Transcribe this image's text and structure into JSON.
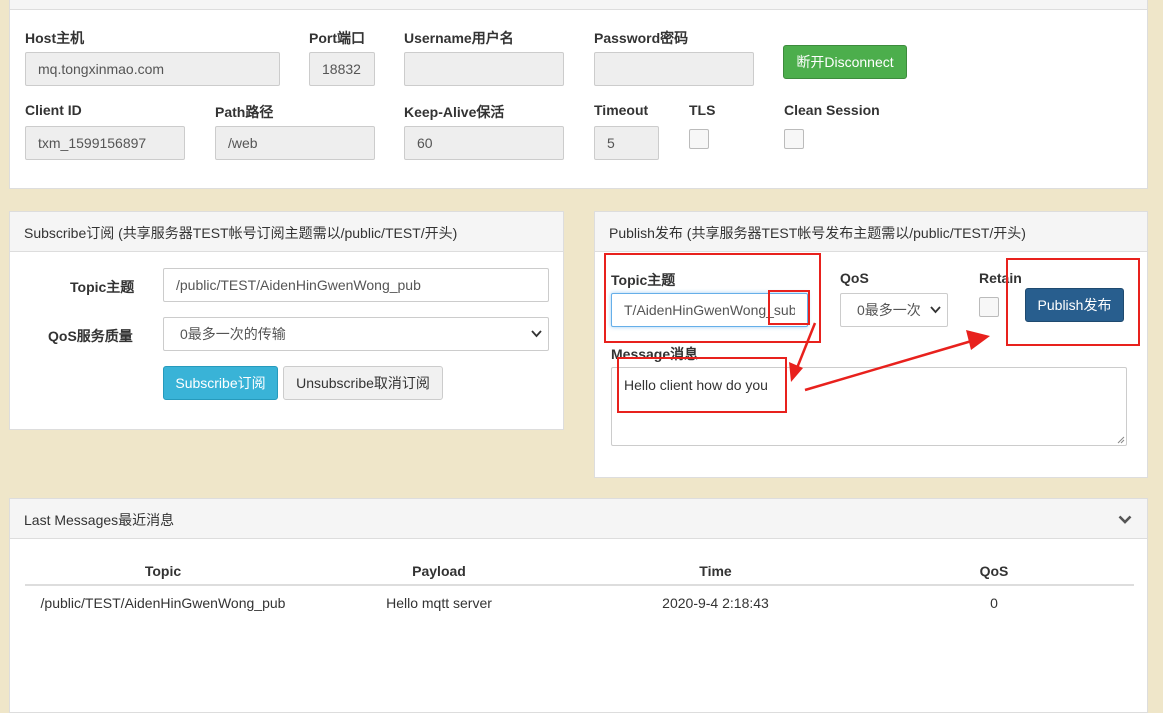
{
  "connection": {
    "host_label": "Host主机",
    "host_value": "mq.tongxinmao.com",
    "port_label": "Port端口",
    "port_value": "18832",
    "username_label": "Username用户名",
    "username_value": "",
    "password_label": "Password密码",
    "password_value": "",
    "disconnect_label": "断开Disconnect",
    "client_id_label": "Client ID",
    "client_id_value": "txm_1599156897",
    "path_label": "Path路径",
    "path_value": "/web",
    "keepalive_label": "Keep-Alive保活",
    "keepalive_value": "60",
    "timeout_label": "Timeout",
    "timeout_value": "5",
    "tls_label": "TLS",
    "clean_session_label": "Clean Session"
  },
  "subscribe": {
    "title": "Subscribe订阅 (共享服务器TEST帐号订阅主题需以/public/TEST/开头)",
    "topic_label": "Topic主题",
    "topic_value": "/public/TEST/AidenHinGwenWong_pub",
    "qos_label": "QoS服务质量",
    "qos_value": "0最多一次的传输",
    "subscribe_button": "Subscribe订阅",
    "unsubscribe_button": "Unsubscribe取消订阅"
  },
  "publish": {
    "title": "Publish发布 (共享服务器TEST帐号发布主题需以/public/TEST/开头)",
    "topic_label": "Topic主题",
    "topic_value": "T/AidenHinGwenWong_sub",
    "qos_label": "QoS",
    "qos_value": "0最多一次",
    "retain_label": "Retain",
    "publish_button": "Publish发布",
    "message_label": "Message消息",
    "message_value": "Hello client how do you"
  },
  "messages": {
    "title": "Last Messages最近消息",
    "columns": [
      "Topic",
      "Payload",
      "Time",
      "QoS"
    ],
    "rows": [
      {
        "topic": "/public/TEST/AidenHinGwenWong_pub",
        "payload": "Hello mqtt server",
        "time": "2020-9-4 2:18:43",
        "qos": "0"
      }
    ]
  },
  "colors": {
    "page_bg": "#efe6c9",
    "disconnect_green": "#4cae4c",
    "subscribe_cyan": "#39b3d7",
    "publish_blue": "#285e8e",
    "annotation_red": "#e8211d"
  },
  "icons": {
    "collapse": "chevron-down-icon",
    "arrow": "annotation-arrow-icon"
  }
}
